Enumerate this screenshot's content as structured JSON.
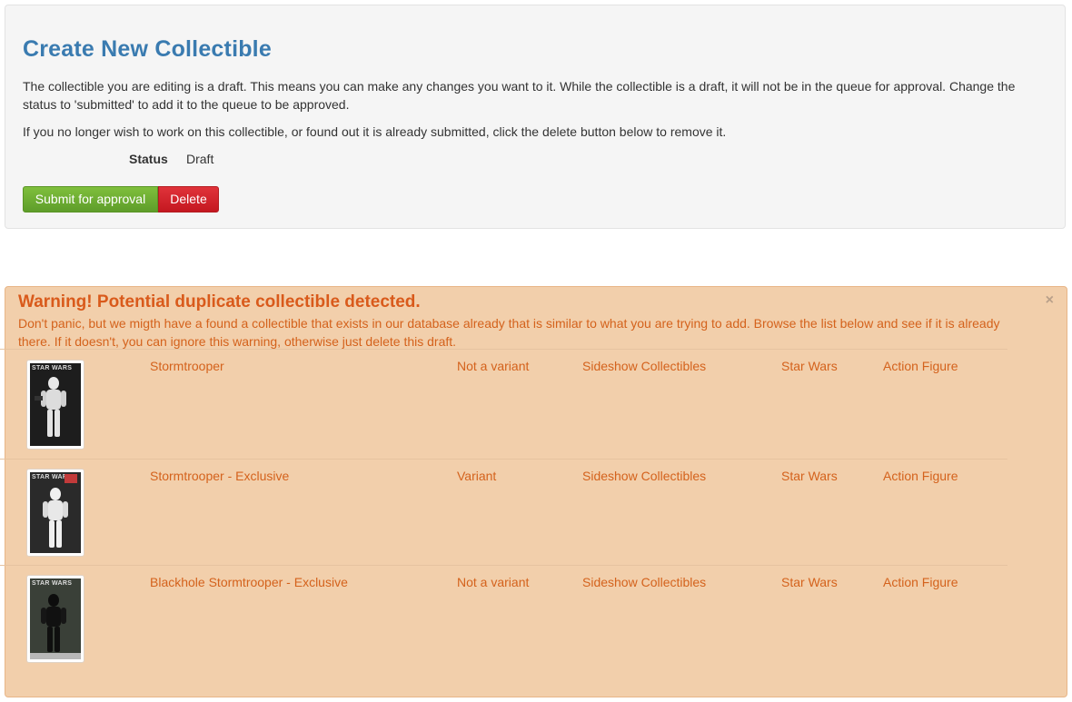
{
  "panel": {
    "title": "Create New Collectible",
    "description": "The collectible you are editing is a draft. This means you can make any changes you want to it. While the collectible is a draft, it will not be in the queue for approval. Change the status to 'submitted' to add it to the queue to be approved.",
    "delete_hint": "If you no longer wish to work on this collectible, or found out it is already submitted, click the delete button below to remove it.",
    "status_label": "Status",
    "status_value": "Draft",
    "submit_label": "Submit for approval",
    "delete_label": "Delete"
  },
  "warning": {
    "title": "Warning! Potential duplicate collectible detected.",
    "close_label": "×",
    "message": "Don't panic, but we migth have a found a collectible that exists in our database already that is similar to what you are trying to add. Browse the list below and see if it is already there. If it doesn't, you can ignore this warning, otherwise just delete this draft.",
    "rows": [
      {
        "name": "Stormtrooper",
        "variant": "Not a variant",
        "manufacturer": "Sideshow Collectibles",
        "license": "Star Wars",
        "type": "Action Figure",
        "image_logo": "STAR WARS"
      },
      {
        "name": "Stormtrooper - Exclusive",
        "variant": "Variant",
        "manufacturer": "Sideshow Collectibles",
        "license": "Star Wars",
        "type": "Action Figure",
        "image_logo": "STAR WARS"
      },
      {
        "name": "Blackhole Stormtrooper - Exclusive",
        "variant": "Not a variant",
        "manufacturer": "Sideshow Collectibles",
        "license": "Star Wars",
        "type": "Action Figure",
        "image_logo": "STAR WARS"
      }
    ]
  },
  "colors": {
    "title_blue": "#3a7bb0",
    "warning_bg": "#f2cfab",
    "warning_text": "#d4621c",
    "submit_green": "#6bab32",
    "delete_red": "#d2232a"
  }
}
